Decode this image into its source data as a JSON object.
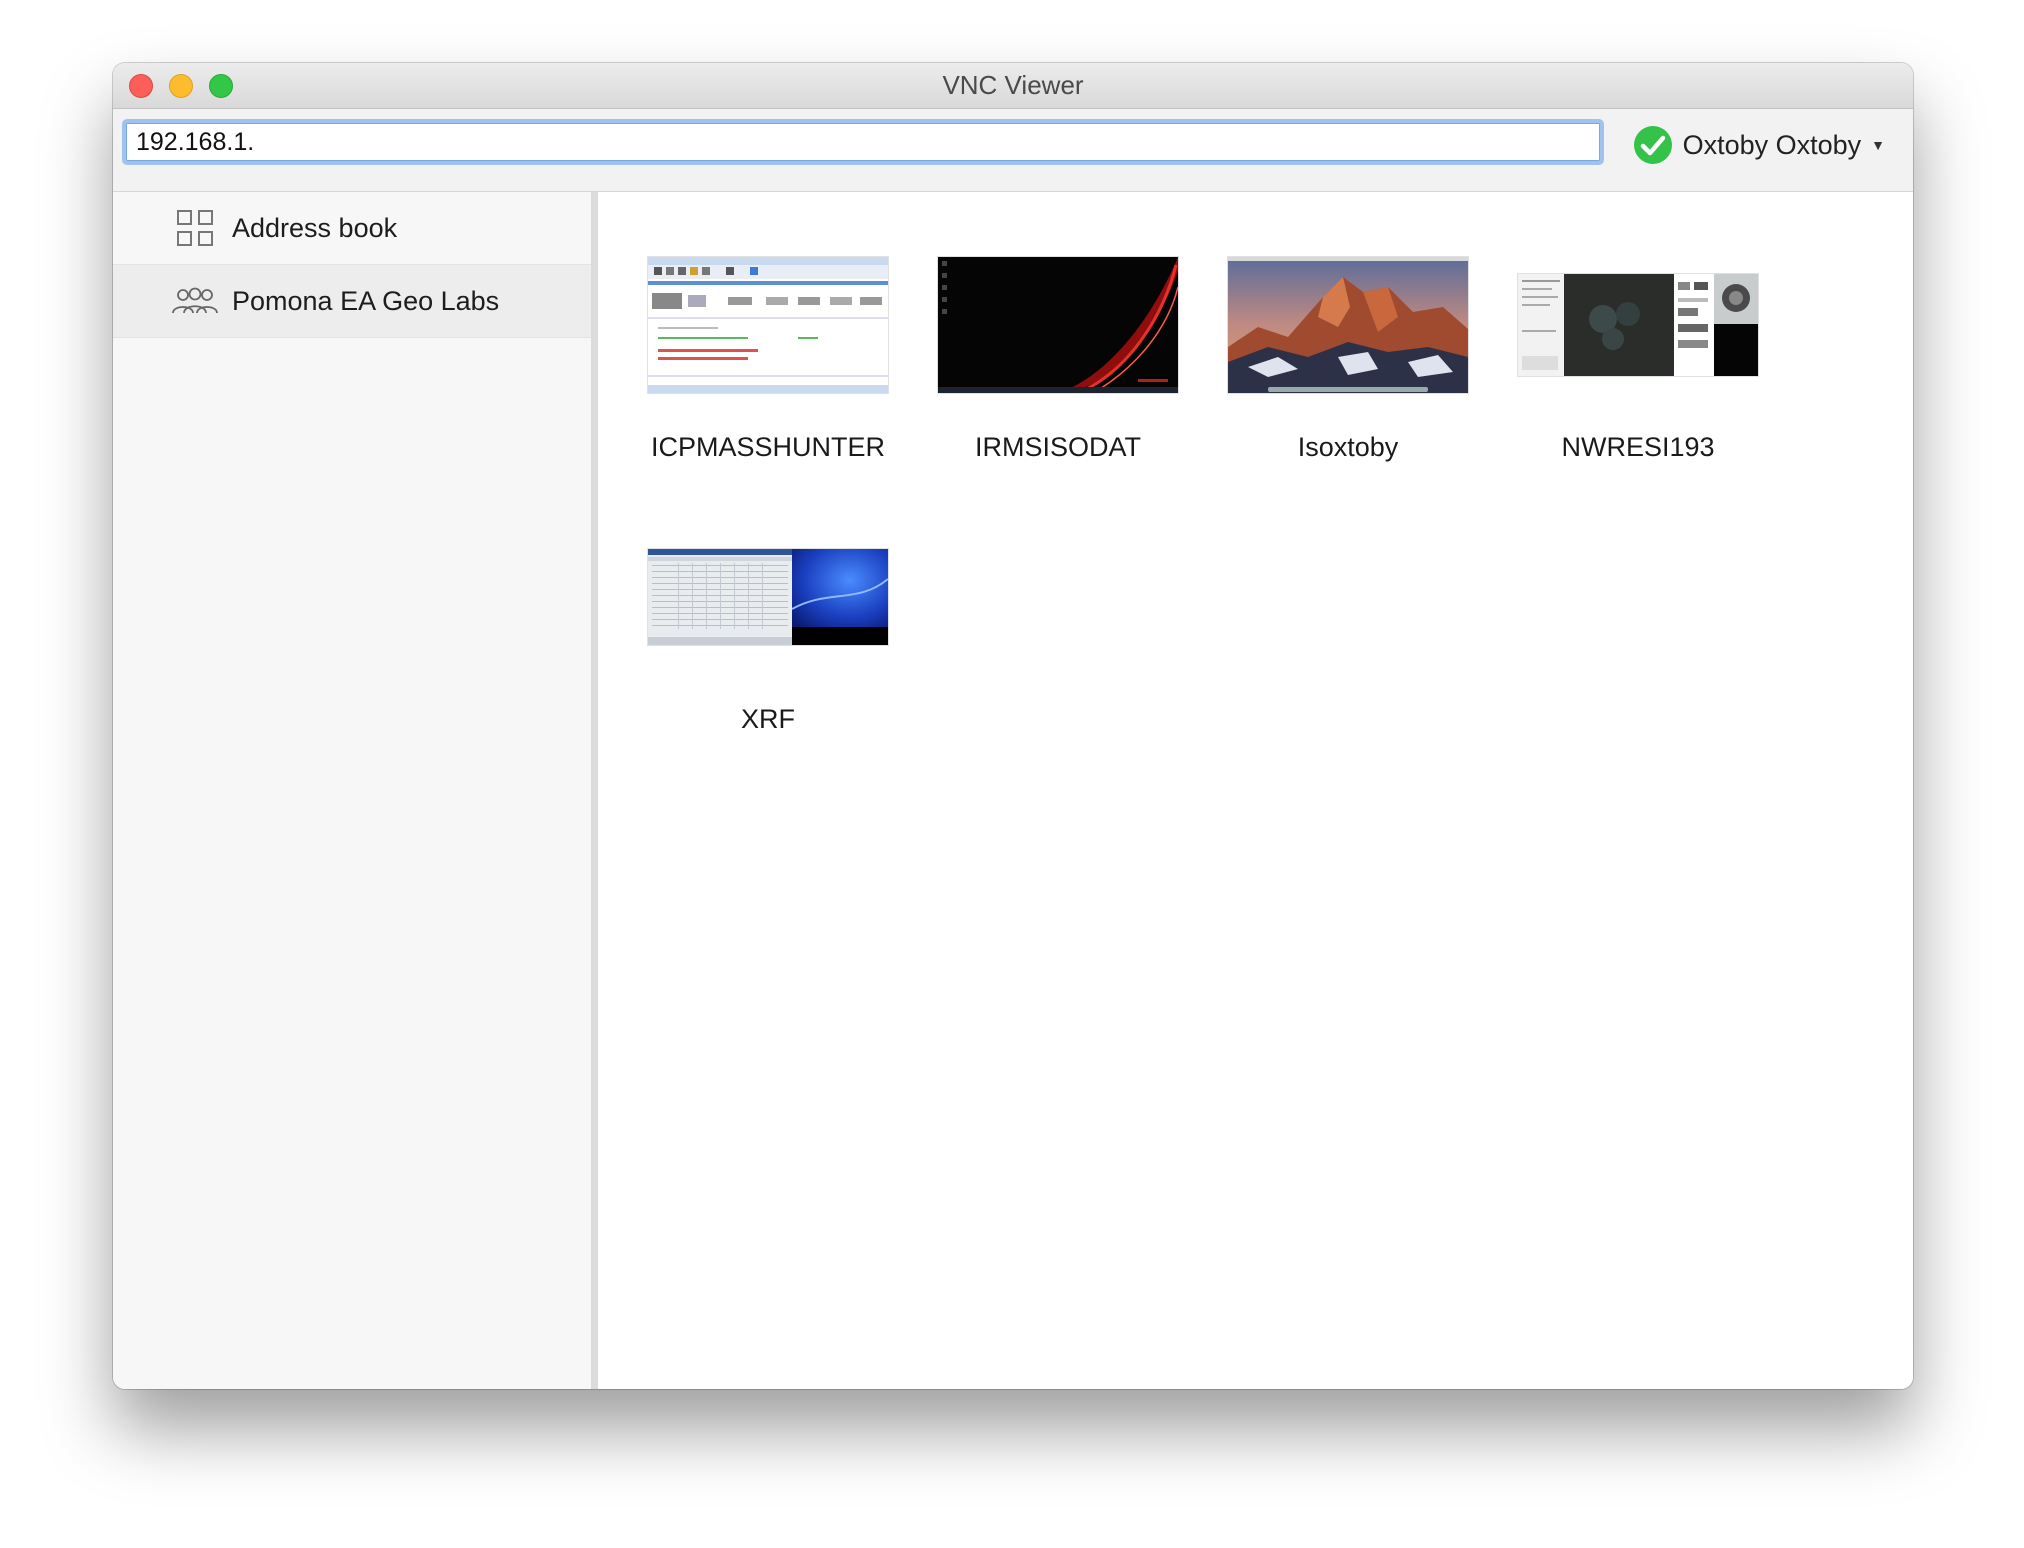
{
  "window": {
    "title": "VNC Viewer"
  },
  "toolbar": {
    "address_value": "192.168.1.",
    "account_name": "Oxtoby Oxtoby",
    "account_status_color": "#34c348"
  },
  "sidebar": {
    "items": [
      {
        "label": "Address book",
        "icon": "grid-icon",
        "selected": false
      },
      {
        "label": "Pomona EA Geo Labs",
        "icon": "team-icon",
        "selected": true
      }
    ]
  },
  "computers": [
    {
      "name": "ICPMASSHUNTER",
      "thumbnail": "windows-software-screenshot"
    },
    {
      "name": "IRMSISODAT",
      "thumbnail": "black-red-desktop"
    },
    {
      "name": "Isoxtoby",
      "thumbnail": "mountain-desktop"
    },
    {
      "name": "NWRESI193",
      "thumbnail": "dark-microscope-software"
    },
    {
      "name": "XRF",
      "thumbnail": "spreadsheet-blue-desktop"
    }
  ]
}
